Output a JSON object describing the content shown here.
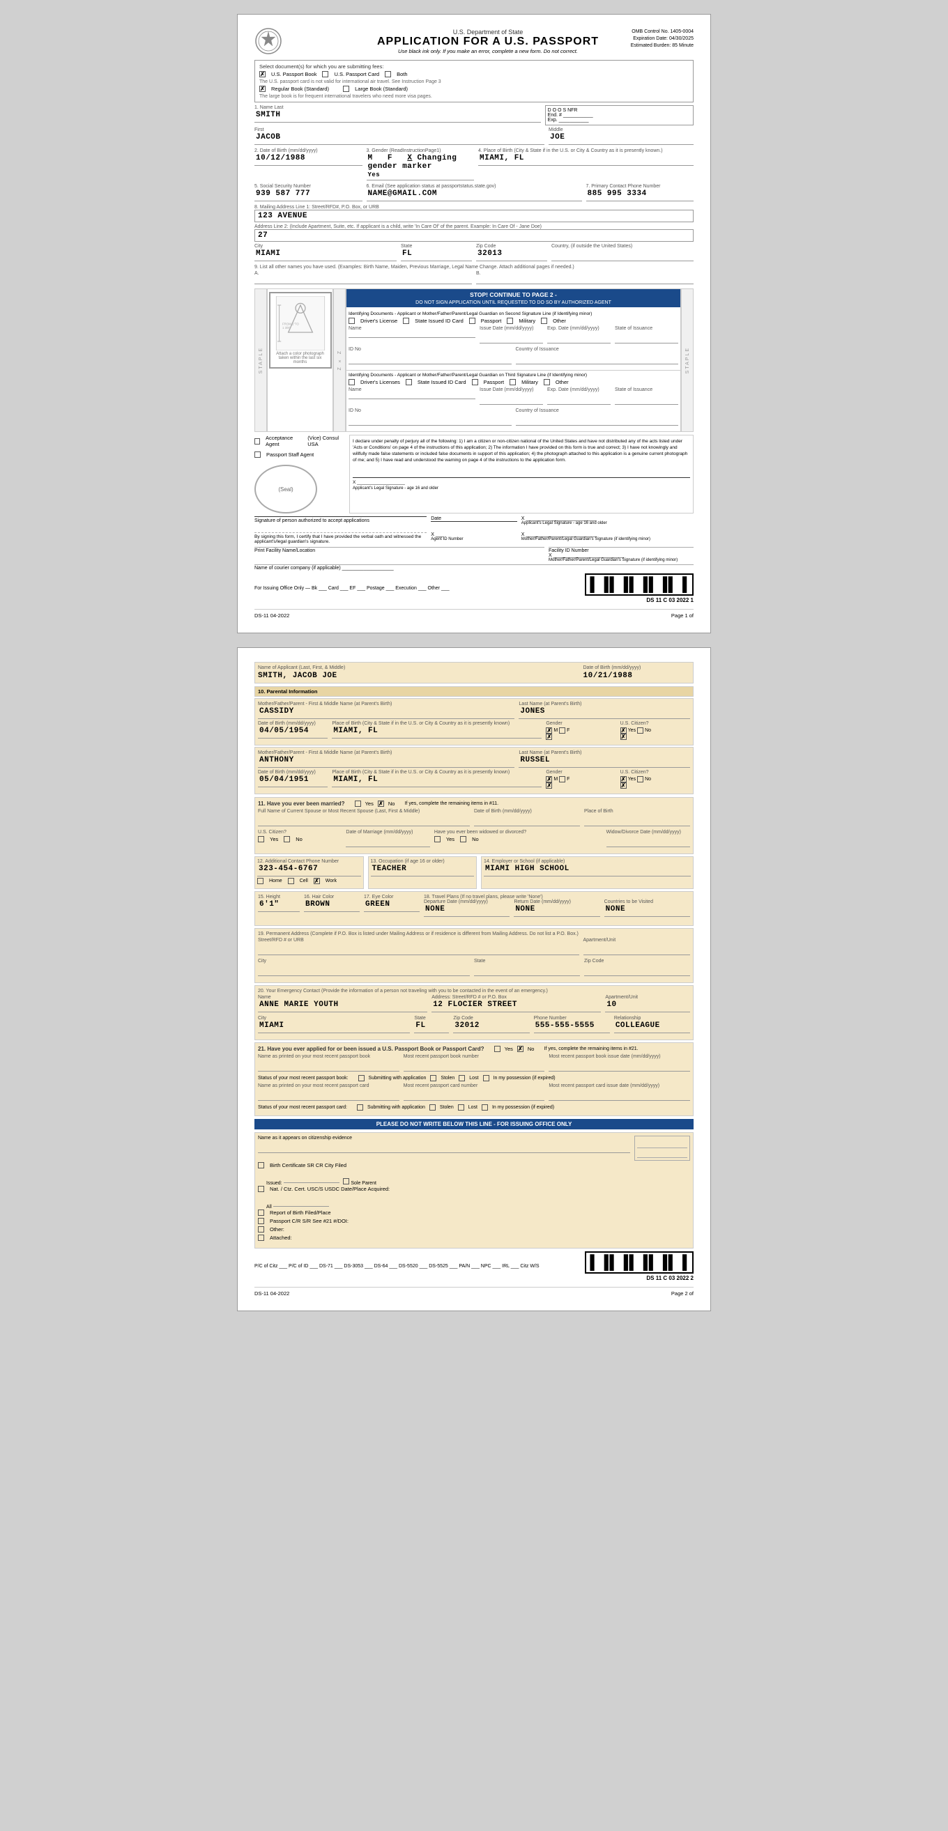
{
  "page1": {
    "dept": "U.S. Department of State",
    "title": "APPLICATION FOR A U.S. PASSPORT",
    "subtitle": "Use black ink only. If you make an error, complete a new form. Do not correct.",
    "omb": {
      "line1": "OMB Control No. 1405-0004",
      "line2": "Expiration Date: 04/30/2025",
      "line3": "Estimated Burden: 85 Minute"
    },
    "select_docs_label": "Select document(s) for which you are submitting fees:",
    "passport_book": "U.S. Passport Book",
    "passport_card": "U.S. Passport Card",
    "both": "Both",
    "regular_book": "Regular Book (Standard)",
    "large_book": "Large Book (Standard)",
    "passport_note": "The U.S. passport card is not valid for international air travel. See Instruction Page 3",
    "large_book_note": "The large book is for frequent international travelers who need more visa pages.",
    "field1_label": "1. Name Last",
    "name_last": "SMITH",
    "name_first": "JACOB",
    "name_middle": "JOE",
    "doos_label": "D O O S NFR",
    "end_label": "End. #",
    "exp_label": "Exp.",
    "field2_label": "2. Date of Birth (mm/dd/yyyy)",
    "dob": "10/12/1988",
    "field3_label": "3. Gender (ReadInstructionPage1)",
    "gender_m": "M",
    "gender_f": "F",
    "gender_x": "X Changing gender marker",
    "gender_yes": "Yes",
    "field4_label": "4. Place of Birth (City & State if in the U.S. or City & Country as it is presently known.)",
    "place_of_birth": "MIAMI, FL",
    "field5_label": "5. Social Security Number",
    "ssn": "939 587 777",
    "field6_label": "6. Email (See application status at passportstatus.state.gov)",
    "email": "NAME@GMAIL.COM",
    "field7_label": "7. Primary Contact Phone Number",
    "phone": "885 995 3334",
    "field8_label": "8. Mailing Address Line 1: Street/RFD#, P.O. Box, or URB",
    "address1": "123 AVENUE",
    "address2_label": "Address Line 2: (Include Apartment, Suite, etc. If applicant is a child, write 'In Care Of' of the parent. Example: In Care Of - Jane Doe)",
    "address2": "27",
    "city_label": "City",
    "city": "MIAMI",
    "state_label": "State",
    "state": "FL",
    "zip_label": "Zip Code",
    "zip": "32013",
    "country_label": "Country, (if outside the United States)",
    "field9_label": "9. List all other names you have used. (Examples: Birth Name, Maiden, Previous Marriage, Legal Name Change. Attach additional pages if needed.)",
    "other_names_a": "A.",
    "other_names_b": "B.",
    "stop_banner": "STOP! CONTINUE TO PAGE 2 -",
    "stop_sub": "DO NOT SIGN APPLICATION UNTIL REQUESTED TO DO SO BY AUTHORIZED AGENT",
    "identifying_docs_label": "Identifying Documents - Applicant or Mother/Father/Parent/Legal Guardian on Second Signature Line (if Identifying minor)",
    "drivers_license": "Driver's License",
    "state_id": "State Issued ID Card",
    "passport": "Passport",
    "military": "Military",
    "other": "Other",
    "name_label": "Name",
    "issue_date_label": "Issue Date (mm/dd/yyyy)",
    "exp_date_label": "Exp. Date (mm/dd/yyyy)",
    "state_of_issuance": "State of Issuance",
    "id_no_label": "ID No",
    "country_of_issuance": "Country of Issuance",
    "third_line_label": "Identifying Documents - Applicant or Mother/Father/Parent/Legal Guardian on Third Signature Line (if Identifying minor)",
    "acceptance_agent": "Acceptance Agent",
    "vice_consul": "(Vice) Consul USA",
    "passport_staff": "Passport Staff Agent",
    "seal_label": "(Seal)",
    "declaration_text": "I declare under penalty of perjury all of the following: 1) I am a citizen or non-citizen national of the United States and have not distributed any of the acts listed under 'Acts or Conditions' on page 4 of the instructions of this application; 2) The information I have provided on this form is true and correct; 3) I have not knowingly and willfully made false statements or included false documents in support of this application; 4) the photograph attached to this application is a genuine current photograph of me; and 5) I have read and understood the warning on page 4 of the instructions to the application form.",
    "sig_label1": "Signature of person authorized to accept applications",
    "date_label": "Date",
    "applicant_sig_label": "Applicant's Legal Signature - age 16 and older",
    "verbal_label": "By signing this form, I certify that I have provided the verbal oath and witnessed the applicant's/legal guardian's signature.",
    "agent_id_label": "Agent ID Number",
    "mother_sig_label": "Mother/Father/Parent/Legal Guardian's Signature (if identifying minor)",
    "print_facility": "Print Facility Name/Location",
    "facility_id": "Facility ID Number",
    "courier_label": "Name of courier company (if applicable)",
    "issuing_label": "For Issuing Office Only — Bk ___ Card ___ EF ___ Postage ___ Execution ___ Other ___",
    "ds_code": "DS 11 C 03 2022 1",
    "form_code": "DS-11 04-2022",
    "page_of": "Page 1 of"
  },
  "page2": {
    "applicant_name_label": "Name of Applicant (Last, First, & Middle)",
    "applicant_name": "SMITH, JACOB JOE",
    "dob_label": "Date of Birth (mm/dd/yyyy)",
    "dob": "10/21/1988",
    "section10_label": "10. Parental Information",
    "mother_first_label": "Mother/Father/Parent - First & Middle Name (at Parent's Birth)",
    "mother_last_label": "Last Name (at Parent's Birth)",
    "mother_first": "CASSIDY",
    "mother_last": "JONES",
    "mother_dob_label": "Date of Birth (mm/dd/yyyy)",
    "mother_dob": "04/05/1954",
    "mother_pob_label": "Place of Birth (City & State if in the U.S. or City & Country as it is presently known)",
    "mother_pob": "MIAMI, FL",
    "mother_gender_label": "Gender",
    "mother_gender": "M",
    "mother_citizen_label": "U.S. Citizen?",
    "mother_citizen": "Yes",
    "father_first_label": "Mother/Father/Parent - First & Middle Name (at Parent's Birth)",
    "father_last_label": "Last Name (at Parent's Birth)",
    "father_first": "ANTHONY",
    "father_last": "RUSSEL",
    "father_dob_label": "Date of Birth (mm/dd/yyyy)",
    "father_dob": "05/04/1951",
    "father_pob_label": "Place of Birth (City & State if in the U.S. or City & Country as it is presently known)",
    "father_pob": "MIAMI, FL",
    "father_gender_label": "Gender",
    "father_gender": "M",
    "father_citizen_label": "U.S. Citizen?",
    "father_citizen": "Yes",
    "section11_label": "11. Have you ever been married?",
    "married_yes": "Yes",
    "married_no": "✗ No",
    "married_if_yes": "If yes, complete the remaining items in #11.",
    "spouse_name_label": "Full Name of Current Spouse or Most Recent Spouse (Last, First & Middle)",
    "spouse_dob_label": "Date of Birth (mm/dd/yyyy)",
    "spouse_pob_label": "Place of Birth",
    "us_citizen_label": "U.S. Citizen?",
    "date_marriage_label": "Date of Marriage (mm/dd/yyyy)",
    "widowed_label": "Have you ever been widowed or divorced?",
    "widow_date_label": "Widow/Divorce Date (mm/dd/yyyy)",
    "section12_label": "12. Additional Contact Phone Number",
    "add_phone": "323-454-6767",
    "home_label": "Home",
    "cell_label": "Cell",
    "work_label": "✗ Work",
    "section13_label": "13. Occupation (if age 16 or older)",
    "occupation": "TEACHER",
    "section14_label": "14. Employer or School (if applicable)",
    "employer": "MIAMI HIGH SCHOOL",
    "section15_label": "15. Height",
    "height": "6'1\"",
    "section16_label": "16. Hair Color",
    "hair_color": "BROWN",
    "section17_label": "17. Eye Color",
    "eye_color": "GREEN",
    "section18_label": "18. Travel Plans (If no travel plans, please write 'None')",
    "depart_date_label": "Departure Date (mm/dd/yyyy)",
    "return_date_label": "Return Date (mm/dd/yyyy)",
    "countries_label": "Countries to be Visited",
    "depart_date": "NONE",
    "return_date": "NONE",
    "countries": "NONE",
    "section19_label": "19. Permanent Address (Complete if P.O. Box is listed under Mailing Address or if residence is different from Mailing Address. Do not list a P.O. Box.)",
    "perm_street_label": "Street/RFD # or URB",
    "perm_apt_label": "Apartment/Unit",
    "perm_city_label": "City",
    "perm_state_label": "State",
    "perm_zip_label": "Zip Code",
    "section20_label": "20. Your Emergency Contact (Provide the information of a person not traveling with you to be contacted in the event of an emergency.)",
    "ec_name_label": "Name",
    "ec_address_label": "Address: Street/RFD # or P.O. Box",
    "ec_apt_label": "Apartment/Unit",
    "ec_name": "ANNE MARIE YOUTH",
    "ec_address": "12 FLOCIER STREET",
    "ec_apt": "10",
    "ec_city_label": "City",
    "ec_state_label": "State",
    "ec_zip_label": "Zip Code",
    "ec_phone_label": "Phone Number",
    "ec_rel_label": "Relationship",
    "ec_city": "MIAMI",
    "ec_state": "FL",
    "ec_zip": "32012",
    "ec_phone": "555-555-5555",
    "ec_rel": "COLLEAGUE",
    "section21_label": "21. Have you ever applied for or been issued a U.S. Passport Book or Passport Card?",
    "q21_yes": "Yes",
    "q21_no": "✗ No",
    "q21_if_yes": "If yes, complete the remaining items in #21.",
    "name_printed_label": "Name as printed on your most recent passport book",
    "book_number_label": "Most recent passport book number",
    "book_date_label": "Most recent passport book issue date (mm/dd/yyyy)",
    "book_status_label": "Status of your most recent passport book:",
    "submitting_label": "Submitting with application",
    "stolen_label": "Stolen",
    "lost_label": "Lost",
    "in_possession_label": "In my possession (if expired)",
    "card_name_label": "Name as printed on your most recent passport card",
    "card_number_label": "Most recent passport card number",
    "card_date_label": "Most recent passport card issue date (mm/dd/yyyy)",
    "card_status_label": "Status of your most recent passport card:",
    "issuing_office_label": "PLEASE DO NOT WRITE BELOW THIS LINE - FOR ISSUING OFFICE ONLY",
    "citizenship_label": "Name as it appears on citizenship evidence",
    "birth_cert_label": "Birth Certificate SR CR City Filed",
    "issued_label": "Issued:",
    "sole_parent_label": "Sole Parent",
    "nat_cert_label": "Nat. / Ctz. Cert. USC/S USDC Date/Place Acquired:",
    "all_label": "All",
    "report_label": "Report of Birth Filed/Place",
    "passport_label": "Passport C/R S/R See #21 #/DOI:",
    "other_label": "Other:",
    "attached_label": "Attached:",
    "footer_codes": "P/C of Citz ___ P/C of ID ___ DS-71 ___ DS-3053 ___ DS-64 ___ DS-5520 ___ DS-5525 ___ PA/N ___ NPC ___ IRL ___ Citz W/S",
    "ds_code": "DS 11 C 03 2022 2",
    "form_code": "DS-11 04-2022",
    "page_of": "Page 2 of"
  }
}
